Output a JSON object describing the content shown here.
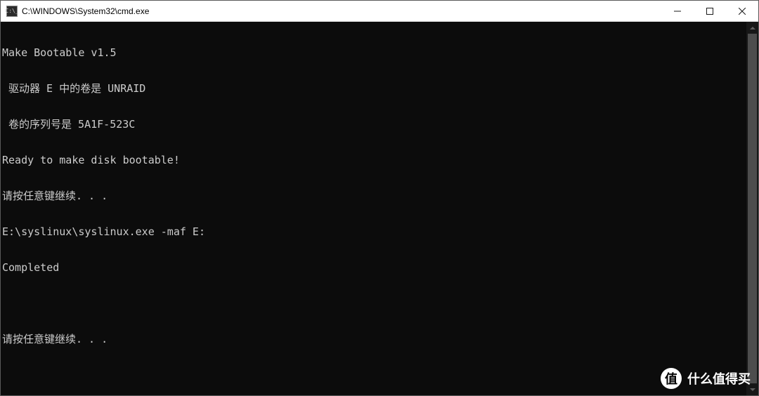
{
  "window": {
    "title": "C:\\WINDOWS\\System32\\cmd.exe",
    "icon_label": "C:\\_"
  },
  "terminal": {
    "lines": [
      "Make Bootable v1.5",
      " 驱动器 E 中的卷是 UNRAID",
      " 卷的序列号是 5A1F-523C",
      "Ready to make disk bootable!",
      "请按任意键继续. . .",
      "E:\\syslinux\\syslinux.exe -maf E:",
      "Completed",
      "",
      "请按任意键继续. . ."
    ]
  },
  "watermark": {
    "badge": "值",
    "text": "什么值得买"
  }
}
